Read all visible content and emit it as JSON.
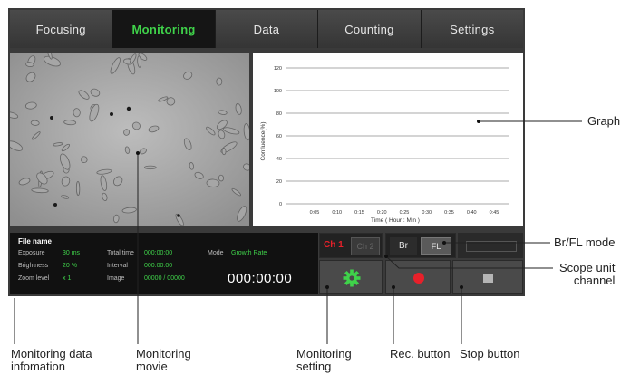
{
  "tabs": [
    {
      "label": "Focusing",
      "active": false
    },
    {
      "label": "Monitoring",
      "active": true
    },
    {
      "label": "Data",
      "active": false
    },
    {
      "label": "Counting",
      "active": false
    },
    {
      "label": "Settings",
      "active": false
    }
  ],
  "info": {
    "title": "File name",
    "exposure_label": "Exposure",
    "exposure_value": "30 ms",
    "brightness_label": "Brightness",
    "brightness_value": "20 %",
    "zoom_label": "Zoom level",
    "zoom_value": "x 1",
    "total_time_label": "Total time",
    "total_time_value": "000:00:00",
    "interval_label": "Interval",
    "interval_value": "000:00:00",
    "image_label": "Image",
    "image_value": "00000 / 00000",
    "mode_label": "Mode",
    "mode_value": "Growth Rate",
    "timer": "000:00:00"
  },
  "controls": {
    "ch1": "Ch 1",
    "ch2": "Ch 2",
    "br": "Br",
    "fl": "FL"
  },
  "chart_data": {
    "type": "line",
    "xlabel": "Time ( Hour : Min )",
    "ylabel": "Confluence(%)",
    "categories": [
      "0:05",
      "0:10",
      "0:15",
      "0:20",
      "0:25",
      "0:30",
      "0:35",
      "0:40",
      "0:45"
    ],
    "yticks": [
      0,
      20,
      40,
      60,
      80,
      100,
      120
    ],
    "ylim": [
      0,
      120
    ],
    "series": []
  },
  "annotations": {
    "graph": "Graph",
    "brfl": "Br/FL mode",
    "scope_line1": "Scope unit",
    "scope_line2": "channel",
    "mon_data_line1": "Monitoring data",
    "mon_data_line2": "infomation",
    "movie_line1": "Monitoring",
    "movie_line2": "movie",
    "setting_line1": "Monitoring",
    "setting_line2": "setting",
    "rec": "Rec. button",
    "stop": "Stop button"
  },
  "colors": {
    "accent_green": "#3fd24a",
    "rec_red": "#e8202a",
    "ch1_red": "#e8202a"
  }
}
